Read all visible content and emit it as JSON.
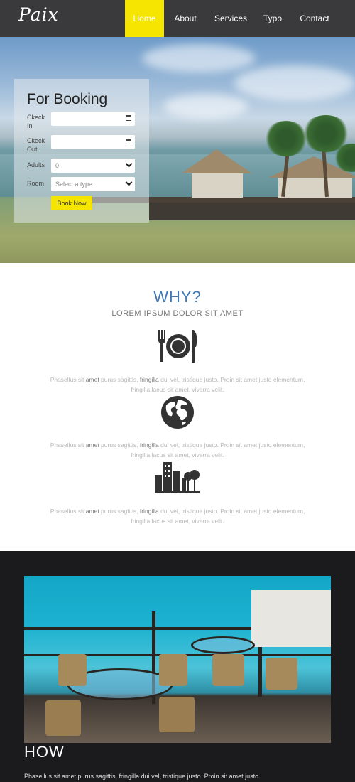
{
  "brand": {
    "logo": "Paix"
  },
  "nav": {
    "items": [
      "Home",
      "About",
      "Services",
      "Typo",
      "Contact"
    ],
    "active": "Home"
  },
  "booking": {
    "title": "For Booking",
    "checkin_label": "Ckeck In",
    "checkout_label": "Ckeck Out",
    "adults_label": "Adults",
    "adults_value": "0",
    "room_label": "Room",
    "room_placeholder": "Select a type",
    "button": "Book Now"
  },
  "why": {
    "title": "WHY?",
    "subtitle": "LOREM IPSUM DOLOR SIT AMET",
    "features": [
      {
        "icon": "dining-icon",
        "line1_a": "Phasellus sit ",
        "line1_b": "amet",
        "line1_c": " purus sagittis, ",
        "line1_d": "fringilla",
        "line1_e": " dui vel, tristique justo. Proin sit amet justo elementum,",
        "line2": "fringilla lacus sit amet, viverra velit."
      },
      {
        "icon": "globe-icon",
        "line1_a": "Phasellus sit ",
        "line1_b": "amet",
        "line1_c": " purus sagittis, ",
        "line1_d": "fringilla",
        "line1_e": " dui vel, tristique justo. Proin sit amet justo elementum,",
        "line2": "fringilla lacus sit amet, viverra velit."
      },
      {
        "icon": "city-icon",
        "line1_a": "Phasellus sit ",
        "line1_b": "amet",
        "line1_c": " purus sagittis, ",
        "line1_d": "fringilla",
        "line1_e": " dui vel, tristique justo. Proin sit amet justo elementum,",
        "line2": "fringilla lacus sit amet, viverra velit."
      }
    ]
  },
  "how": {
    "title": "HOW",
    "text": "Phasellus sit amet purus sagittis, fringilla dui vel, tristique justo. Proin sit amet justo"
  },
  "colors": {
    "nav_bg": "#3a393c",
    "accent": "#f6e500",
    "why_title": "#3f78b5",
    "how_bg": "#1b1a1c"
  }
}
